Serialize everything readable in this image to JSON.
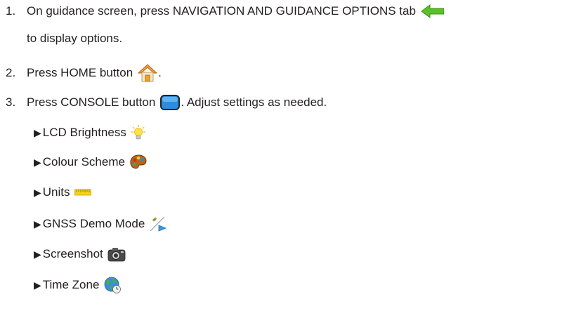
{
  "steps": [
    {
      "number": "1.",
      "text": "On guidance screen, press NAVIGATION AND GUIDANCE OPTIONS tab",
      "continuation": "to display options.",
      "icon": "green-left-arrow-icon"
    },
    {
      "number": "2.",
      "text": "Press HOME button",
      "suffix": ".",
      "icon": "home-icon"
    },
    {
      "number": "3.",
      "text": "Press CONSOLE button",
      "suffix": ". Adjust settings as needed.",
      "icon": "console-icon"
    }
  ],
  "settings": [
    {
      "bullet": "▶",
      "label": "LCD Brightness",
      "icon": "lightbulb-icon"
    },
    {
      "bullet": "▶",
      "label": "Colour Scheme",
      "icon": "palette-icon"
    },
    {
      "bullet": "▶",
      "label": "Units",
      "icon": "ruler-icon"
    },
    {
      "bullet": "▶",
      "label": "GNSS Demo Mode",
      "icon": "satellite-demo-icon"
    },
    {
      "bullet": "▶",
      "label": "Screenshot",
      "icon": "camera-icon"
    },
    {
      "bullet": "▶",
      "label": "Time Zone",
      "icon": "globe-clock-icon"
    }
  ],
  "colors": {
    "text": "#231f20",
    "arrow": "#4caf1e",
    "console": "#1f7fd1",
    "home_roof": "#e07a1a"
  }
}
